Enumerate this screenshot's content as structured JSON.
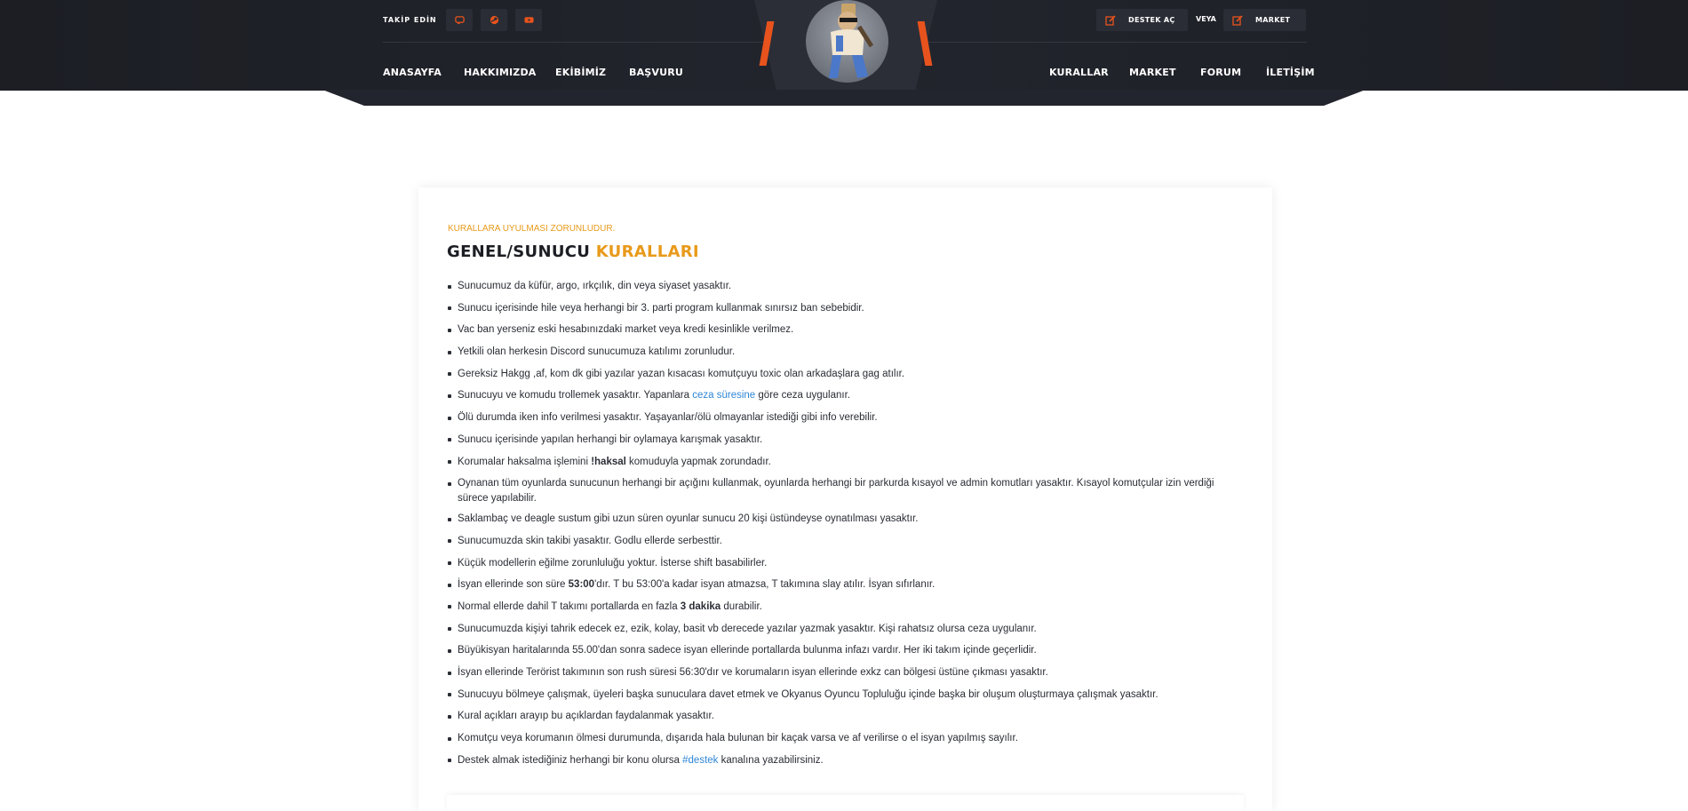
{
  "header": {
    "follow_label": "TAKİP EDİN",
    "social_icons": [
      "discord-icon",
      "steam-icon",
      "youtube-icon"
    ],
    "support_button": "DESTEK AÇ",
    "or_label": "VEYA",
    "market_button": "MARKET",
    "nav_left": [
      "ANASAYFA",
      "HAKKIMIZDA",
      "EKİBİMİZ",
      "BAŞVURU"
    ],
    "nav_right": [
      "KURALLAR",
      "MARKET",
      "FORUM",
      "İLETİŞİM"
    ],
    "accent_color": "#e8531d"
  },
  "rules_card": {
    "subtitle": "KURALLARA UYULMASI ZORUNLUDUR.",
    "title_main": "GENEL/SUNUCU ",
    "title_accent": "KURALLARI",
    "accent_color": "#e89a1a",
    "link_color": "#2f86d6",
    "items": [
      {
        "t": "Sunucumuz da küfür, argo, ırkçılık, din veya siyaset yasaktır."
      },
      {
        "t": "Sunucu içerisinde hile veya herhangi bir 3. parti program kullanmak sınırsız ban sebebidir."
      },
      {
        "t": "Vac ban yerseniz eski hesabınızdaki market veya kredi kesinlikle verilmez."
      },
      {
        "t": "Yetkili olan herkesin Discord sunucumuza katılımı zorunludur."
      },
      {
        "t": "Gereksiz Hakgg ,af, kom dk gibi yazılar yazan kısacası komutçuyu toxic olan arkadaşlara gag atılır."
      },
      {
        "pre": "Sunucuyu ve komudu trollemek yasaktır. Yapanlara ",
        "link": "ceza süresine",
        "post": " göre ceza uygulanır."
      },
      {
        "t": "Ölü durumda iken info verilmesi yasaktır. Yaşayanlar/ölü olmayanlar istediği gibi info verebilir."
      },
      {
        "t": "Sunucu içerisinde yapılan herhangi bir oylamaya karışmak yasaktır."
      },
      {
        "pre": "Korumalar haksalma işlemini ",
        "bold": "!haksal",
        "post": " komuduyla yapmak zorundadır."
      },
      {
        "t": "Oynanan tüm oyunlarda sunucunun herhangi bir açığını kullanmak, oyunlarda herhangi bir parkurda kısayol ve admin komutları yasaktır. Kısayol komutçular izin verdiği sürece yapılabilir."
      },
      {
        "t": "Saklambaç ve deagle sustum gibi uzun süren oyunlar sunucu 20 kişi üstündeyse oynatılması yasaktır."
      },
      {
        "t": "Sunucumuzda skin takibi yasaktır. Godlu ellerde serbesttir."
      },
      {
        "t": "Küçük modellerin eğilme zorunluluğu yoktur. İsterse shift basabilirler."
      },
      {
        "pre": "İsyan ellerinde son süre ",
        "bold": "53:00",
        "post": "'dır. T bu 53:00'a kadar isyan atmazsa, T takımına slay atılır. İsyan sıfırlanır."
      },
      {
        "pre": "Normal ellerde dahil T takımı portallarda en fazla ",
        "bold": "3 dakika",
        "post": " durabilir."
      },
      {
        "t": "Sunucumuzda kişiyi tahrik edecek ez, ezik, kolay, basit vb derecede yazılar yazmak yasaktır. Kişi rahatsız olursa ceza uygulanır."
      },
      {
        "t": "Büyükisyan haritalarında 55.00'dan sonra sadece isyan ellerinde portallarda bulunma infazı vardır. Her iki takım içinde geçerlidir."
      },
      {
        "t": "İsyan ellerinde Terörist takımının son rush süresi 56:30'dır ve korumaların isyan ellerinde exkz can bölgesi üstüne çıkması yasaktır."
      },
      {
        "t": "Sunucuyu bölmeye çalışmak, üyeleri başka sunuculara davet etmek ve Okyanus Oyuncu Topluluğu içinde başka bir oluşum oluşturmaya çalışmak yasaktır."
      },
      {
        "t": "Kural açıkları arayıp bu açıklardan faydalanmak yasaktır."
      },
      {
        "t": "Komutçu veya korumanın ölmesi durumunda, dışarıda hala bulunan bir kaçak varsa ve af verilirse o el isyan yapılmış sayılır."
      },
      {
        "pre": "Destek almak istediğiniz herhangi bir konu olursa ",
        "link": "#destek",
        "post": " kanalına yazabilirsiniz."
      }
    ]
  }
}
